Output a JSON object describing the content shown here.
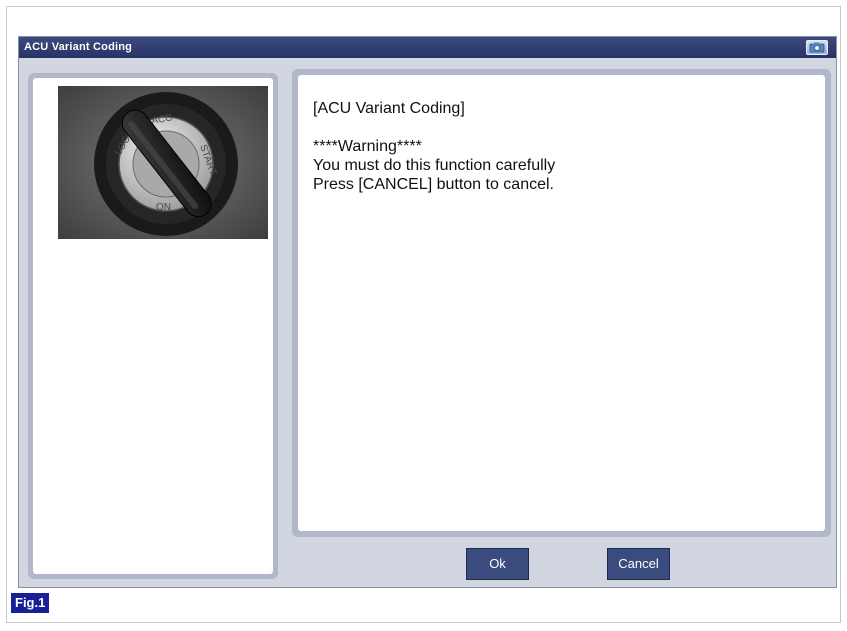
{
  "window": {
    "title": "ACU Variant Coding",
    "title_icon": "camera-icon"
  },
  "message": {
    "title": "[ACU Variant Coding]",
    "lines": [
      "****Warning****",
      "You must do this function carefully",
      "Press [CANCEL] button to cancel."
    ]
  },
  "buttons": {
    "ok": "Ok",
    "cancel": "Cancel"
  },
  "image": {
    "icon": "ignition-switch-icon",
    "switch_labels": [
      "LOCK",
      "ACC",
      "START",
      "ON"
    ]
  },
  "figure_label": "Fig.1",
  "colors": {
    "titlebar": "#2f3d72",
    "panel_frame": "#b0b8ca",
    "button": "#3a4c7d",
    "fig_badge": "#1b1f96"
  }
}
